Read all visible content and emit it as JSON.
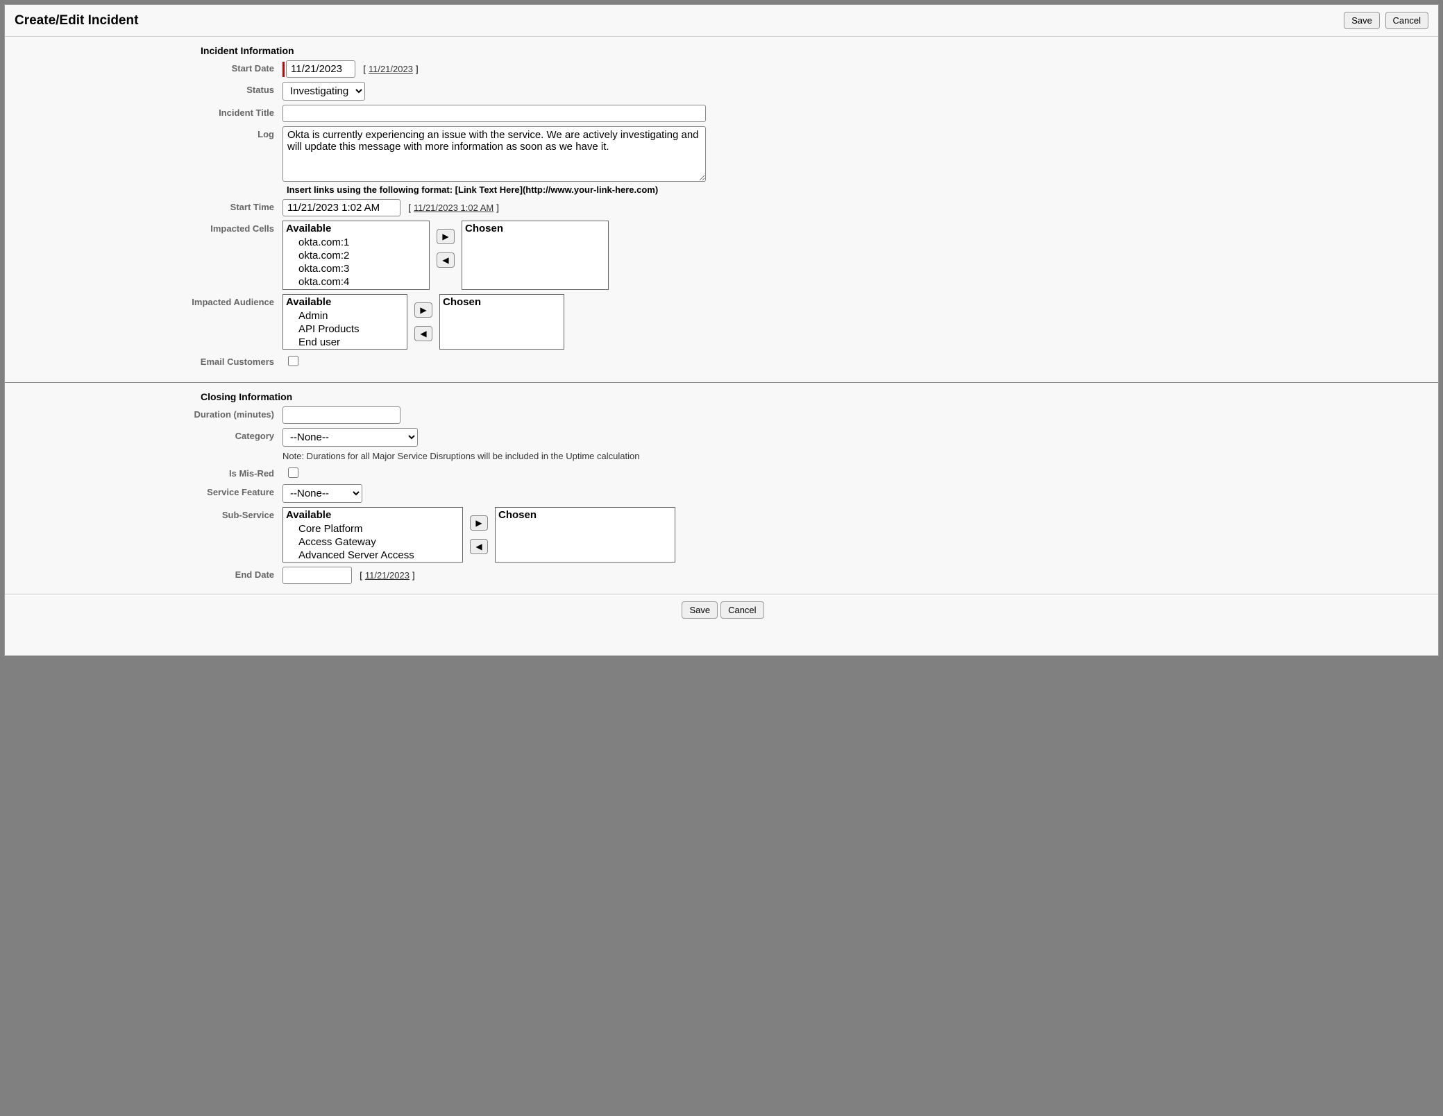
{
  "header": {
    "title": "Create/Edit Incident",
    "save": "Save",
    "cancel": "Cancel"
  },
  "incident": {
    "section_title": "Incident Information",
    "labels": {
      "start_date": "Start Date",
      "status": "Status",
      "incident_title": "Incident Title",
      "log": "Log",
      "start_time": "Start Time",
      "impacted_cells": "Impacted Cells",
      "impacted_audience": "Impacted Audience",
      "email_customers": "Email Customers"
    },
    "start_date": {
      "value": "11/21/2023",
      "link": "11/21/2023"
    },
    "status": {
      "selected": "Investigating",
      "options": [
        "Investigating"
      ]
    },
    "incident_title": "",
    "log": "Okta is currently experiencing an issue with the service. We are actively investigating and will update this message with more information as soon as we have it.",
    "log_hint": "Insert links using the following format: [Link Text Here](http://www.your-link-here.com)",
    "start_time": {
      "value": "11/21/2023 1:02 AM",
      "link": "11/21/2023 1:02 AM"
    },
    "cells": {
      "available_title": "Available",
      "chosen_title": "Chosen",
      "available": [
        "okta.com:1",
        "okta.com:2",
        "okta.com:3",
        "okta.com:4"
      ],
      "chosen": []
    },
    "audience": {
      "available_title": "Available",
      "chosen_title": "Chosen",
      "available": [
        "Admin",
        "API Products",
        "End user"
      ],
      "chosen": []
    },
    "email_customers": false
  },
  "closing": {
    "section_title": "Closing Information",
    "labels": {
      "duration": "Duration (minutes)",
      "category": "Category",
      "is_mis_red": "Is Mis-Red",
      "service_feature": "Service Feature",
      "sub_service": "Sub-Service",
      "end_date": "End Date"
    },
    "duration": "",
    "category": {
      "selected": "--None--",
      "options": [
        "--None--"
      ]
    },
    "category_note": "Note: Durations for all Major Service Disruptions will be included in the Uptime calculation",
    "is_mis_red": false,
    "service_feature": {
      "selected": "--None--",
      "options": [
        "--None--"
      ]
    },
    "sub_service": {
      "available_title": "Available",
      "chosen_title": "Chosen",
      "available": [
        "Core Platform",
        "Access Gateway",
        "Advanced Server Access"
      ],
      "chosen": []
    },
    "end_date": {
      "value": "",
      "link": "11/21/2023"
    }
  },
  "footer": {
    "save": "Save",
    "cancel": "Cancel"
  }
}
